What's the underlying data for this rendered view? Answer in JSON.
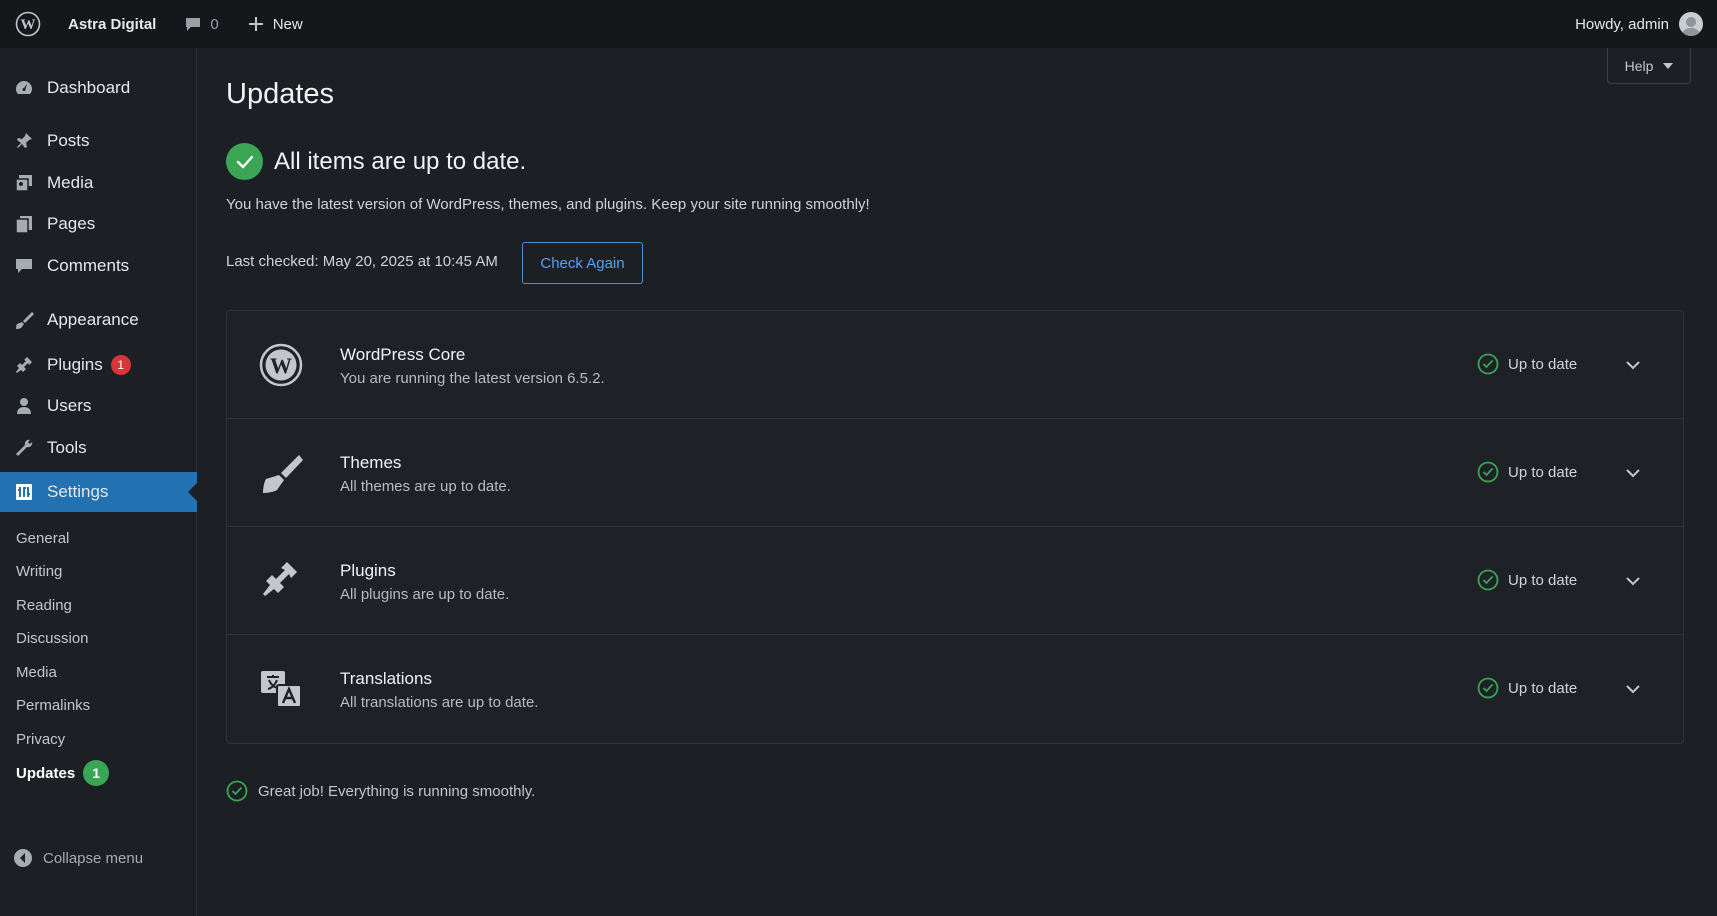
{
  "adminbar": {
    "site_name": "Astra Digital",
    "comments_count": "0",
    "new_label": "New",
    "howdy": "Howdy, admin"
  },
  "sidebar": {
    "items": [
      {
        "label": "Dashboard",
        "icon": "dashboard-icon"
      },
      {
        "label": "Posts",
        "icon": "pin-icon"
      },
      {
        "label": "Media",
        "icon": "media-icon"
      },
      {
        "label": "Pages",
        "icon": "pages-icon"
      },
      {
        "label": "Comments",
        "icon": "comment-icon"
      },
      {
        "label": "Appearance",
        "icon": "brush-icon"
      },
      {
        "label": "Plugins",
        "icon": "plug-icon",
        "badge": "1"
      },
      {
        "label": "Users",
        "icon": "user-icon"
      },
      {
        "label": "Tools",
        "icon": "wrench-icon"
      },
      {
        "label": "Settings",
        "icon": "settings-icon"
      }
    ],
    "submenu": [
      {
        "label": "General"
      },
      {
        "label": "Writing"
      },
      {
        "label": "Reading"
      },
      {
        "label": "Discussion"
      },
      {
        "label": "Media"
      },
      {
        "label": "Permalinks"
      },
      {
        "label": "Privacy"
      },
      {
        "label": "Updates",
        "badge": "1"
      }
    ],
    "collapse_label": "Collapse menu"
  },
  "help_label": "Help",
  "main": {
    "title": "Updates",
    "status_heading": "All items are up to date.",
    "description": "You have the latest version of WordPress, themes, and plugins. Keep your site running smoothly!",
    "last_checked": "Last checked: May 20, 2025 at 10:45 AM",
    "check_again_label": "Check Again",
    "rows": [
      {
        "title": "WordPress Core",
        "subtitle": "You are running the latest version 6.5.2.",
        "status": "Up to date",
        "icon": "wordpress-icon"
      },
      {
        "title": "Themes",
        "subtitle": "All themes are up to date.",
        "status": "Up to date",
        "icon": "brush-icon"
      },
      {
        "title": "Plugins",
        "subtitle": "All plugins are up to date.",
        "status": "Up to date",
        "icon": "plug-icon"
      },
      {
        "title": "Translations",
        "subtitle": "All translations are up to date.",
        "status": "Up to date",
        "icon": "translation-icon"
      }
    ],
    "footer_message": "Great job! Everything is running smoothly."
  },
  "colors": {
    "accent": "#2271b1",
    "success": "#3aa655",
    "badge_red": "#d63638",
    "link": "#5aa0ea"
  }
}
